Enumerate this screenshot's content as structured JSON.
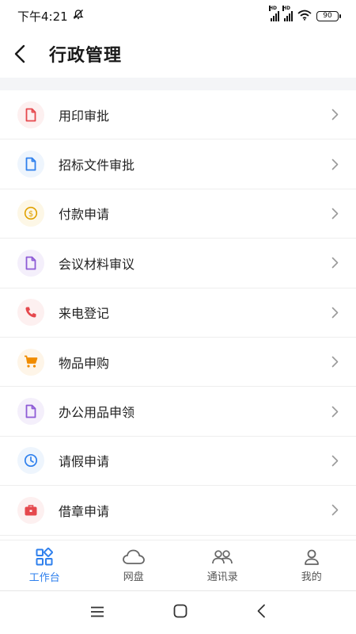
{
  "status_bar": {
    "time": "下午4:21",
    "battery": "90"
  },
  "header": {
    "title": "行政管理"
  },
  "menu": {
    "items": [
      {
        "label": "用印审批",
        "icon": "document-icon",
        "color": "#e5484d",
        "bg": "#fdf0f0"
      },
      {
        "label": "招标文件审批",
        "icon": "document-icon",
        "color": "#2f80ed",
        "bg": "#eef5fd"
      },
      {
        "label": "付款申请",
        "icon": "coin-icon",
        "color": "#e0a100",
        "bg": "#fdf7e6"
      },
      {
        "label": "会议材料审议",
        "icon": "document-icon",
        "color": "#8e5bd6",
        "bg": "#f4effb"
      },
      {
        "label": "来电登记",
        "icon": "phone-icon",
        "color": "#e5484d",
        "bg": "#fdf0f0"
      },
      {
        "label": "物品申购",
        "icon": "cart-icon",
        "color": "#f08c00",
        "bg": "#fef5e8"
      },
      {
        "label": "办公用品申领",
        "icon": "document-icon",
        "color": "#8e5bd6",
        "bg": "#f4effb"
      },
      {
        "label": "请假申请",
        "icon": "clock-icon",
        "color": "#2f80ed",
        "bg": "#eef5fd"
      },
      {
        "label": "借章申请",
        "icon": "briefcase-icon",
        "color": "#e5484d",
        "bg": "#fdf0f0"
      }
    ]
  },
  "bottom_nav": {
    "items": [
      {
        "label": "工作台",
        "icon": "workbench-icon",
        "active": true
      },
      {
        "label": "网盘",
        "icon": "cloud-icon",
        "active": false
      },
      {
        "label": "通讯录",
        "icon": "contacts-icon",
        "active": false
      },
      {
        "label": "我的",
        "icon": "profile-icon",
        "active": false
      }
    ],
    "active_color": "#2f80ed"
  }
}
